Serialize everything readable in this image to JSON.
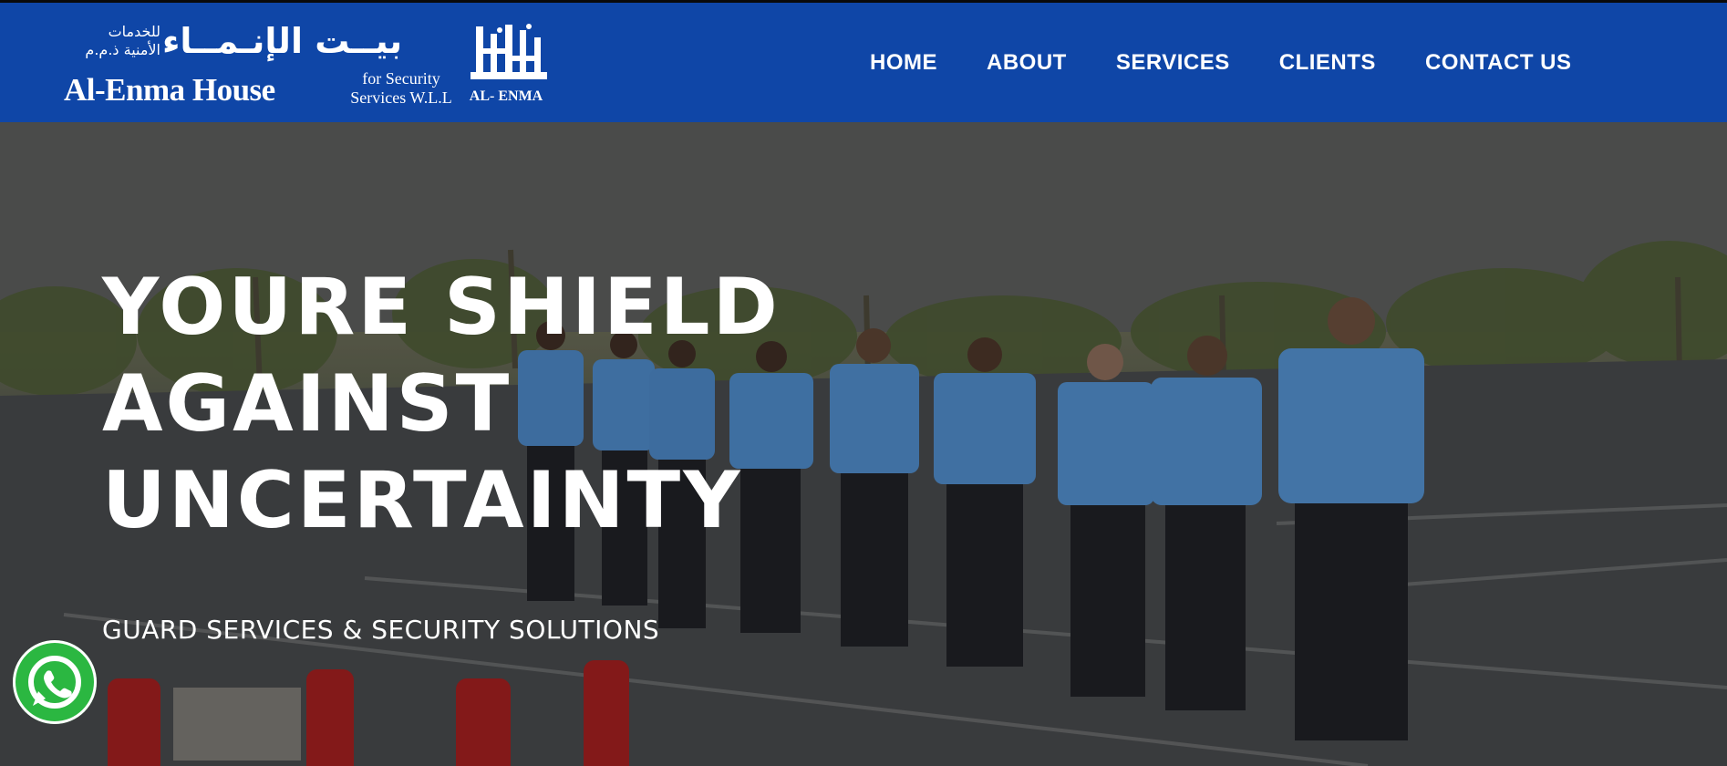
{
  "brand": {
    "arabic_small": "للخدمات الأمنية ذ.م.م",
    "arabic_name": "بيــت الإنـمــاء",
    "english_name": "Al-Enma House",
    "subtitle_line1": "for Security",
    "subtitle_line2": "Services W.L.L",
    "mark_caption": "AL- ENMA",
    "color": "#0f46a7"
  },
  "nav": {
    "items": [
      {
        "label": "HOME"
      },
      {
        "label": "ABOUT"
      },
      {
        "label": "SERVICES"
      },
      {
        "label": "CLIENTS"
      },
      {
        "label": "CONTACT US"
      }
    ]
  },
  "hero": {
    "title_line1": "YOURE SHIELD",
    "title_line2": "AGAINST",
    "title_line3": "UNCERTAINTY",
    "subtitle": "GUARD SERVICES & SECURITY SOLUTIONS",
    "image_icon": "security-guards-photo"
  },
  "whatsapp": {
    "icon": "whatsapp-icon",
    "color": "#2bb741"
  }
}
